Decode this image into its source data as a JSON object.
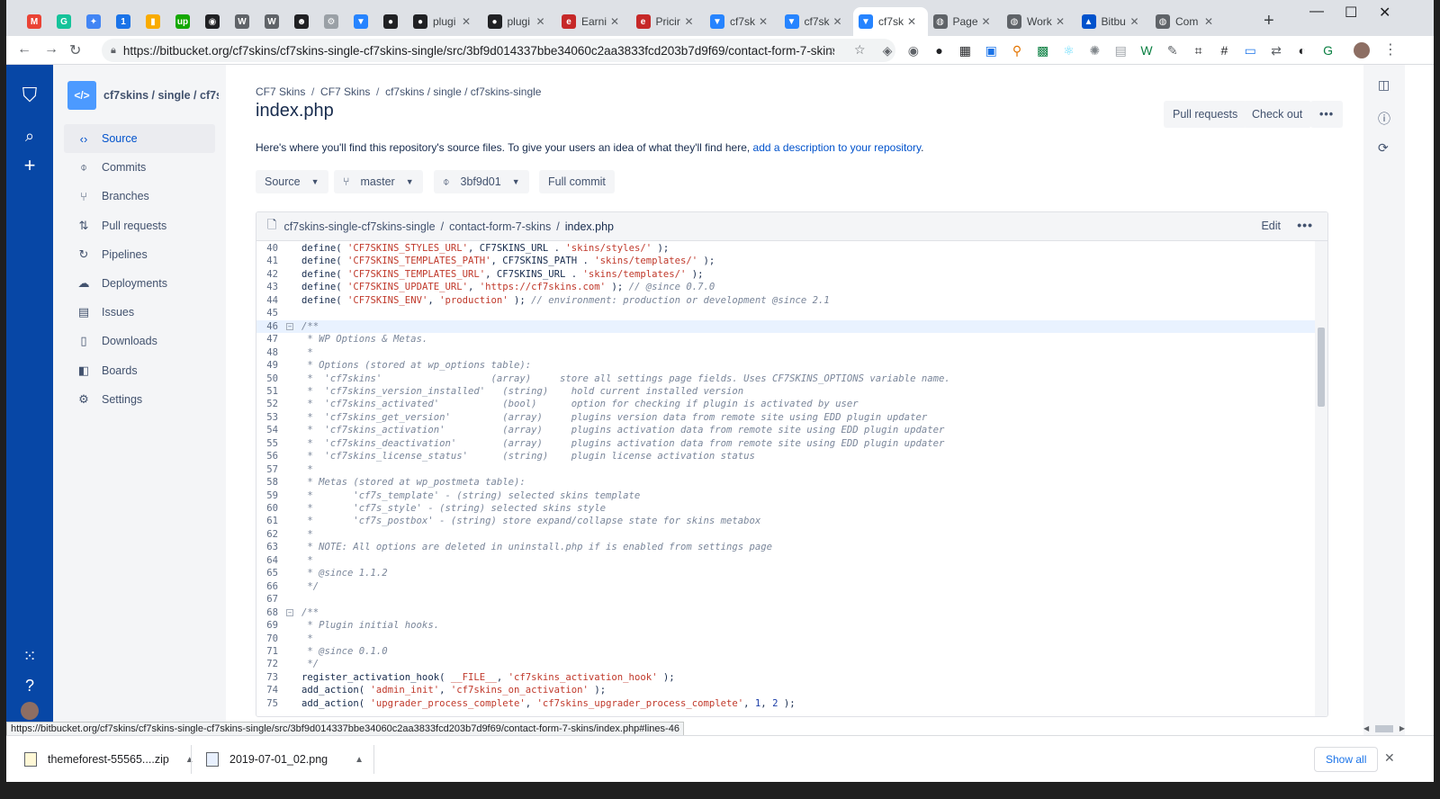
{
  "browser": {
    "tabs": [
      {
        "title": "",
        "icon": "gmail-icon",
        "color": "#ea4335",
        "glyph": "M"
      },
      {
        "title": "",
        "icon": "grammarly-icon",
        "color": "#15c39a",
        "glyph": "G"
      },
      {
        "title": "",
        "icon": "extension-icon",
        "color": "#4285f4",
        "glyph": "✦"
      },
      {
        "title": "",
        "icon": "calendar-icon",
        "color": "#1a73e8",
        "glyph": "1"
      },
      {
        "title": "",
        "icon": "analytics-icon",
        "color": "#f9ab00",
        "glyph": "▮"
      },
      {
        "title": "",
        "icon": "upwork-icon",
        "color": "#14a800",
        "glyph": "up"
      },
      {
        "title": "",
        "icon": "target-icon",
        "color": "#202124",
        "glyph": "◉"
      },
      {
        "title": "",
        "icon": "wordpress-icon",
        "color": "#5f6368",
        "glyph": "W"
      },
      {
        "title": "",
        "icon": "wordpress-icon",
        "color": "#5f6368",
        "glyph": "W"
      },
      {
        "title": "",
        "icon": "emoji-icon",
        "color": "#202124",
        "glyph": "☻"
      },
      {
        "title": "",
        "icon": "gear-icon",
        "color": "#9aa0a6",
        "glyph": "⚙"
      },
      {
        "title": "",
        "icon": "bitbucket-icon",
        "color": "#2684ff",
        "glyph": "▼"
      },
      {
        "title": "",
        "icon": "github-icon",
        "color": "#202124",
        "glyph": "●"
      },
      {
        "title": "plugi",
        "icon": "github-icon",
        "color": "#202124",
        "glyph": "●"
      },
      {
        "title": "plugi",
        "icon": "github-icon",
        "color": "#202124",
        "glyph": "●"
      },
      {
        "title": "Earni",
        "icon": "envato-icon",
        "color": "#c62828",
        "glyph": "e"
      },
      {
        "title": "Pricir",
        "icon": "envato-icon",
        "color": "#c62828",
        "glyph": "e"
      },
      {
        "title": "cf7sk",
        "icon": "bitbucket-icon",
        "color": "#2684ff",
        "glyph": "▼"
      },
      {
        "title": "cf7sk",
        "icon": "bitbucket-icon",
        "color": "#2684ff",
        "glyph": "▼"
      },
      {
        "title": "cf7sk",
        "icon": "bitbucket-icon",
        "color": "#2684ff",
        "glyph": "▼"
      },
      {
        "title": "Page",
        "icon": "globe-icon",
        "color": "#5f6368",
        "glyph": "◍"
      },
      {
        "title": "Work",
        "icon": "globe-icon",
        "color": "#5f6368",
        "glyph": "◍"
      },
      {
        "title": "Bitbu",
        "icon": "atlassian-icon",
        "color": "#0052cc",
        "glyph": "▲"
      },
      {
        "title": "Com",
        "icon": "globe-icon",
        "color": "#5f6368",
        "glyph": "◍"
      }
    ],
    "url": "https://bitbucket.org/cf7skins/cf7skins-single-cf7skins-single/src/3bf9d014337bbe34060c2aa3833fcd203b7d9f69/contact-form-7-skins/in..."
  },
  "sidebar": {
    "repo_name": "cf7skins / single / cf7s...",
    "items": [
      {
        "label": "Source",
        "icon": "code-icon",
        "glyph": "‹›",
        "selected": true
      },
      {
        "label": "Commits",
        "icon": "commit-icon",
        "glyph": "⌽"
      },
      {
        "label": "Branches",
        "icon": "branch-icon",
        "glyph": "⑂"
      },
      {
        "label": "Pull requests",
        "icon": "pull-request-icon",
        "glyph": "⇅"
      },
      {
        "label": "Pipelines",
        "icon": "pipelines-icon",
        "glyph": "↻"
      },
      {
        "label": "Deployments",
        "icon": "cloud-upload-icon",
        "glyph": "☁"
      },
      {
        "label": "Issues",
        "icon": "issues-icon",
        "glyph": "▤"
      },
      {
        "label": "Downloads",
        "icon": "document-icon",
        "glyph": "▯"
      },
      {
        "label": "Boards",
        "icon": "board-icon",
        "glyph": "◧"
      },
      {
        "label": "Settings",
        "icon": "gear-icon",
        "glyph": "⚙"
      }
    ]
  },
  "main": {
    "breadcrumbs": [
      "CF7 Skins",
      "CF7 Skins",
      "cf7skins / single / cf7skins-single"
    ],
    "title": "index.php",
    "pull_requests_label": "Pull requests",
    "check_out_label": "Check out",
    "more_label": "•••",
    "description_text": "Here's where you'll find this repository's source files. To give your users an idea of what they'll find here, ",
    "description_link": "add a description to your repository",
    "description_end": ".",
    "source_selector": "Source",
    "branch_selector": "master",
    "commit_selector": "3bf9d01",
    "full_commit_label": "Full commit"
  },
  "file": {
    "path": [
      "cf7skins-single-cf7skins-single",
      "contact-form-7-skins",
      "index.php"
    ],
    "edit_label": "Edit",
    "lines": [
      {
        "n": "40",
        "seg": [
          [
            "define( ",
            ""
          ],
          [
            "'CF7SKINS_STYLES_URL'",
            "s"
          ],
          [
            ", CF7SKINS_URL . ",
            ""
          ],
          [
            "'skins/styles/'",
            "s"
          ],
          [
            " );",
            ""
          ]
        ]
      },
      {
        "n": "41",
        "seg": [
          [
            "define( ",
            ""
          ],
          [
            "'CF7SKINS_TEMPLATES_PATH'",
            "s"
          ],
          [
            ", CF7SKINS_PATH . ",
            ""
          ],
          [
            "'skins/templates/'",
            "s"
          ],
          [
            " );",
            ""
          ]
        ]
      },
      {
        "n": "42",
        "seg": [
          [
            "define( ",
            ""
          ],
          [
            "'CF7SKINS_TEMPLATES_URL'",
            "s"
          ],
          [
            ", CF7SKINS_URL . ",
            ""
          ],
          [
            "'skins/templates/'",
            "s"
          ],
          [
            " );",
            ""
          ]
        ]
      },
      {
        "n": "43",
        "seg": [
          [
            "define( ",
            ""
          ],
          [
            "'CF7SKINS_UPDATE_URL'",
            "s"
          ],
          [
            ", ",
            ""
          ],
          [
            "'https://cf7skins.com'",
            "s"
          ],
          [
            " ); ",
            ""
          ],
          [
            "// @since 0.7.0",
            "c"
          ]
        ]
      },
      {
        "n": "44",
        "seg": [
          [
            "define( ",
            ""
          ],
          [
            "'CF7SKINS_ENV'",
            "s"
          ],
          [
            ", ",
            ""
          ],
          [
            "'production'",
            "s"
          ],
          [
            " ); ",
            ""
          ],
          [
            "// environment: production or development @since 2.1",
            "c"
          ]
        ]
      },
      {
        "n": "45",
        "seg": []
      },
      {
        "n": "46",
        "fold": true,
        "hl": true,
        "seg": [
          [
            "/**",
            "c"
          ]
        ]
      },
      {
        "n": "47",
        "seg": [
          [
            " * WP Options & Metas.",
            "c"
          ]
        ]
      },
      {
        "n": "48",
        "seg": [
          [
            " *",
            "c"
          ]
        ]
      },
      {
        "n": "49",
        "seg": [
          [
            " * Options (stored at wp_options table):",
            "c"
          ]
        ]
      },
      {
        "n": "50",
        "seg": [
          [
            " *  'cf7skins'                   (array)     store all settings page fields. Uses CF7SKINS_OPTIONS variable name.",
            "c"
          ]
        ]
      },
      {
        "n": "51",
        "seg": [
          [
            " *  'cf7skins_version_installed'   (string)    hold current installed version",
            "c"
          ]
        ]
      },
      {
        "n": "52",
        "seg": [
          [
            " *  'cf7skins_activated'           (bool)      option for checking if plugin is activated by user",
            "c"
          ]
        ]
      },
      {
        "n": "53",
        "seg": [
          [
            " *  'cf7skins_get_version'         (array)     plugins version data from remote site using EDD plugin updater",
            "c"
          ]
        ]
      },
      {
        "n": "54",
        "seg": [
          [
            " *  'cf7skins_activation'          (array)     plugins activation data from remote site using EDD plugin updater",
            "c"
          ]
        ]
      },
      {
        "n": "55",
        "seg": [
          [
            " *  'cf7skins_deactivation'        (array)     plugins activation data from remote site using EDD plugin updater",
            "c"
          ]
        ]
      },
      {
        "n": "56",
        "seg": [
          [
            " *  'cf7skins_license_status'      (string)    plugin license activation status",
            "c"
          ]
        ]
      },
      {
        "n": "57",
        "seg": [
          [
            " *",
            "c"
          ]
        ]
      },
      {
        "n": "58",
        "seg": [
          [
            " * Metas (stored at wp_postmeta table):",
            "c"
          ]
        ]
      },
      {
        "n": "59",
        "seg": [
          [
            " *       'cf7s_template' - (string) selected skins template",
            "c"
          ]
        ]
      },
      {
        "n": "60",
        "seg": [
          [
            " *       'cf7s_style' - (string) selected skins style",
            "c"
          ]
        ]
      },
      {
        "n": "61",
        "seg": [
          [
            " *       'cf7s_postbox' - (string) store expand/collapse state for skins metabox",
            "c"
          ]
        ]
      },
      {
        "n": "62",
        "seg": [
          [
            " *",
            "c"
          ]
        ]
      },
      {
        "n": "63",
        "seg": [
          [
            " * NOTE: All options are deleted in uninstall.php if is enabled from settings page",
            "c"
          ]
        ]
      },
      {
        "n": "64",
        "seg": [
          [
            " *",
            "c"
          ]
        ]
      },
      {
        "n": "65",
        "seg": [
          [
            " * @since 1.1.2",
            "c"
          ]
        ]
      },
      {
        "n": "66",
        "seg": [
          [
            " */",
            "c"
          ]
        ]
      },
      {
        "n": "67",
        "seg": []
      },
      {
        "n": "68",
        "fold": true,
        "seg": [
          [
            "/**",
            "c"
          ]
        ]
      },
      {
        "n": "69",
        "seg": [
          [
            " * Plugin initial hooks.",
            "c"
          ]
        ]
      },
      {
        "n": "70",
        "seg": [
          [
            " *",
            "c"
          ]
        ]
      },
      {
        "n": "71",
        "seg": [
          [
            " * @since 0.1.0",
            "c"
          ]
        ]
      },
      {
        "n": "72",
        "seg": [
          [
            " */",
            "c"
          ]
        ]
      },
      {
        "n": "73",
        "seg": [
          [
            "register_activation_hook( ",
            ""
          ],
          [
            "__FILE__",
            "s"
          ],
          [
            ", ",
            ""
          ],
          [
            "'cf7skins_activation_hook'",
            "s"
          ],
          [
            " );",
            ""
          ]
        ]
      },
      {
        "n": "74",
        "seg": [
          [
            "add_action( ",
            ""
          ],
          [
            "'admin_init'",
            "s"
          ],
          [
            ", ",
            ""
          ],
          [
            "'cf7skins_on_activation'",
            "s"
          ],
          [
            " );",
            ""
          ]
        ]
      },
      {
        "n": "75",
        "seg": [
          [
            "add_action( ",
            ""
          ],
          [
            "'upgrader_process_complete'",
            "s"
          ],
          [
            ", ",
            ""
          ],
          [
            "'cf7skins_upgrader_process_complete'",
            "s"
          ],
          [
            ", ",
            ""
          ],
          [
            "1",
            "n"
          ],
          [
            ", ",
            ""
          ],
          [
            "2",
            "n"
          ],
          [
            " );",
            ""
          ]
        ]
      }
    ]
  },
  "status_url": "https://bitbucket.org/cf7skins/cf7skins-single-cf7skins-single/src/3bf9d014337bbe34060c2aa3833fcd203b7d9f69/contact-form-7-skins/index.php#lines-46",
  "downloads": {
    "items": [
      "themeforest-55565....zip",
      "2019-07-01_02.png"
    ],
    "show_all_label": "Show all"
  }
}
